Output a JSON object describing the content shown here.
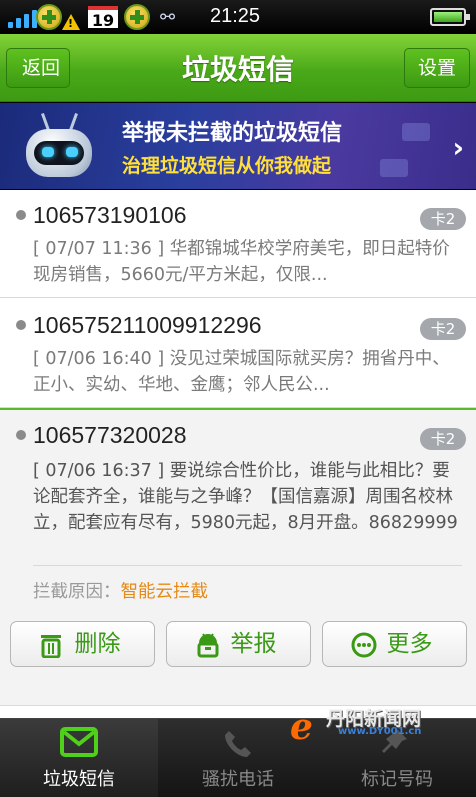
{
  "status_bar": {
    "time": "21:25",
    "date_icon_text": "19",
    "warning_icon_text": "!",
    "icons": [
      "signal-icon",
      "plus-app-icon",
      "warning-icon",
      "calendar-icon",
      "usb-icon",
      "battery-icon"
    ]
  },
  "header": {
    "title": "垃圾短信",
    "back_label": "返回",
    "settings_label": "设置"
  },
  "banner": {
    "title": "举报未拦截的垃圾短信",
    "subtitle": "治理垃圾短信从你我做起",
    "chevron": "›"
  },
  "messages": [
    {
      "number": "106573190106",
      "sim": "卡2",
      "preview": "[ 07/07 11:36 ] 华都锦城华校学府美宅，即日起特价现房销售，5660元/平方米起，仅限..."
    },
    {
      "number": "106575211009912296",
      "sim": "卡2",
      "preview": "[ 07/06 16:40 ] 没见过荣城国际就买房？拥省丹中、正小、实幼、华地、金鹰；邻人民公..."
    },
    {
      "number": "106577320028",
      "sim": "卡2",
      "preview": "[ 07/06 16:37 ] 要说综合性价比，谁能与此相比？要论配套齐全，谁能与之争峰？【国信嘉源】周围名校林立，配套应有尽有，5980元起，8月开盘。86829999",
      "reason_label": "拦截原因：",
      "reason_value": "智能云拦截"
    }
  ],
  "actions": {
    "delete_label": "删除",
    "report_label": "举报",
    "more_label": "更多"
  },
  "bottom_nav": {
    "tabs": [
      {
        "label": "垃圾短信",
        "icon": "message-icon",
        "selected": true
      },
      {
        "label": "骚扰电话",
        "icon": "phone-icon",
        "selected": false
      },
      {
        "label": "标记号码",
        "icon": "pin-icon",
        "selected": false
      }
    ]
  },
  "watermark": {
    "text": "丹阳新闻网",
    "url": "www.DY001.cn"
  },
  "colors": {
    "accent_green": "#4aa919",
    "banner_blue": "#2a3f9e",
    "reason_orange": "#e58a16"
  }
}
